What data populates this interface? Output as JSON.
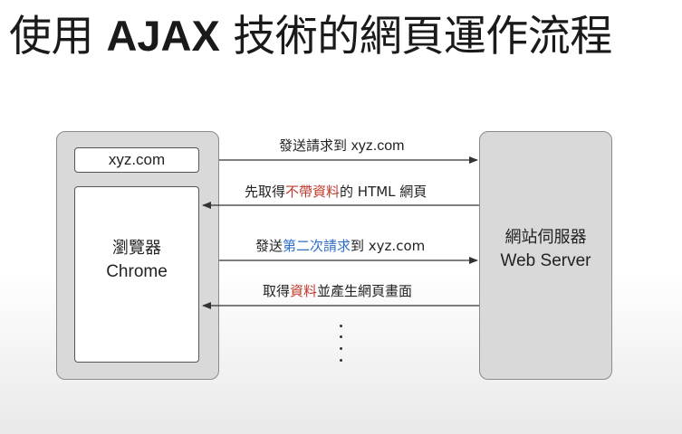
{
  "title": {
    "part1": "使用 ",
    "part2": "AJAX",
    "part3": " 技術的網頁運作流程"
  },
  "browser": {
    "url": "xyz.com",
    "label_line1": "瀏覽器",
    "label_line2": "Chrome"
  },
  "server": {
    "label_line1": "網站伺服器",
    "label_line2": "Web Server"
  },
  "messages": [
    {
      "direction": "to-server",
      "segments": [
        {
          "text": "發送請求到 ",
          "color": "default"
        },
        {
          "text": "xyz.com",
          "color": "default"
        }
      ]
    },
    {
      "direction": "to-browser",
      "segments": [
        {
          "text": "先取得",
          "color": "default"
        },
        {
          "text": "不帶資料",
          "color": "red"
        },
        {
          "text": "的 HTML 網頁",
          "color": "default"
        }
      ]
    },
    {
      "direction": "to-server",
      "segments": [
        {
          "text": "發送",
          "color": "default"
        },
        {
          "text": "第二次請求",
          "color": "blue"
        },
        {
          "text": "到 xyz.com",
          "color": "default"
        }
      ]
    },
    {
      "direction": "to-browser",
      "segments": [
        {
          "text": "取得",
          "color": "default"
        },
        {
          "text": "資料",
          "color": "red"
        },
        {
          "text": "並產生網頁畫面",
          "color": "default"
        }
      ]
    }
  ],
  "colors": {
    "red": "#c0392b",
    "blue": "#2e6ec9",
    "panel": "#d9d9d9"
  }
}
